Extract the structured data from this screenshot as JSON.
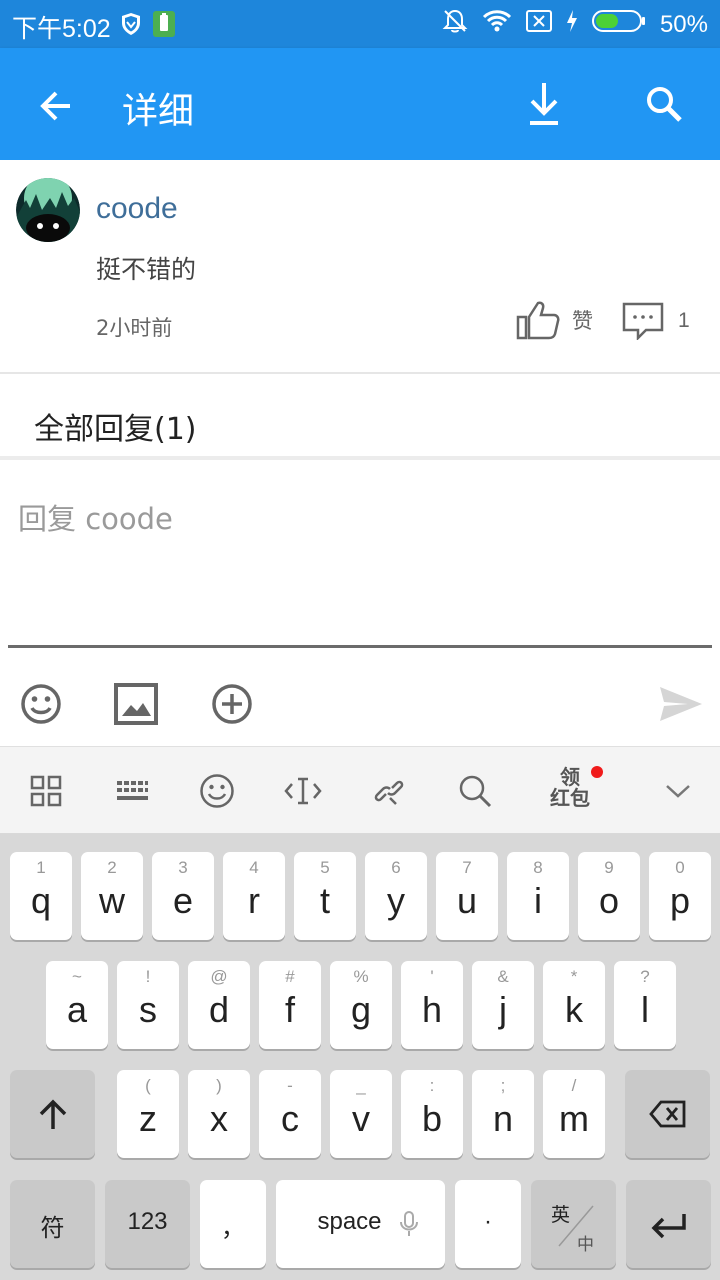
{
  "status_bar": {
    "time": "下午5:02",
    "battery_percent": "50%"
  },
  "app_bar": {
    "title": "详细"
  },
  "comment": {
    "username": "coode",
    "text": "挺不错的",
    "time": "2小时前",
    "like_label": "赞",
    "reply_count": "1"
  },
  "replies_header": "全部回复(1)",
  "reply_input": {
    "placeholder": "回复 coode",
    "value": ""
  },
  "keyboard": {
    "toolbar": {
      "redpacket_top": "领",
      "redpacket_bottom": "红包"
    },
    "row1": [
      {
        "hint": "1",
        "key": "q"
      },
      {
        "hint": "2",
        "key": "w"
      },
      {
        "hint": "3",
        "key": "e"
      },
      {
        "hint": "4",
        "key": "r"
      },
      {
        "hint": "5",
        "key": "t"
      },
      {
        "hint": "6",
        "key": "y"
      },
      {
        "hint": "7",
        "key": "u"
      },
      {
        "hint": "8",
        "key": "i"
      },
      {
        "hint": "9",
        "key": "o"
      },
      {
        "hint": "0",
        "key": "p"
      }
    ],
    "row2": [
      {
        "hint": "~",
        "key": "a"
      },
      {
        "hint": "!",
        "key": "s"
      },
      {
        "hint": "@",
        "key": "d"
      },
      {
        "hint": "#",
        "key": "f"
      },
      {
        "hint": "%",
        "key": "g"
      },
      {
        "hint": "'",
        "key": "h"
      },
      {
        "hint": "&",
        "key": "j"
      },
      {
        "hint": "*",
        "key": "k"
      },
      {
        "hint": "?",
        "key": "l"
      }
    ],
    "row3": [
      {
        "hint": "(",
        "key": "z"
      },
      {
        "hint": ")",
        "key": "x"
      },
      {
        "hint": "-",
        "key": "c"
      },
      {
        "hint": "_",
        "key": "v"
      },
      {
        "hint": ":",
        "key": "b"
      },
      {
        "hint": ";",
        "key": "n"
      },
      {
        "hint": "/",
        "key": "m"
      }
    ],
    "symbols_label": "符",
    "numbers_label": "123",
    "comma_label": "，",
    "space_label": "space",
    "period_label": "·",
    "lang_top": "英",
    "lang_bottom": "中"
  },
  "colors": {
    "status_bar": "#1e86db",
    "app_bar": "#2196f3",
    "username": "#3f6e99",
    "red_dot": "#f01b1b"
  }
}
